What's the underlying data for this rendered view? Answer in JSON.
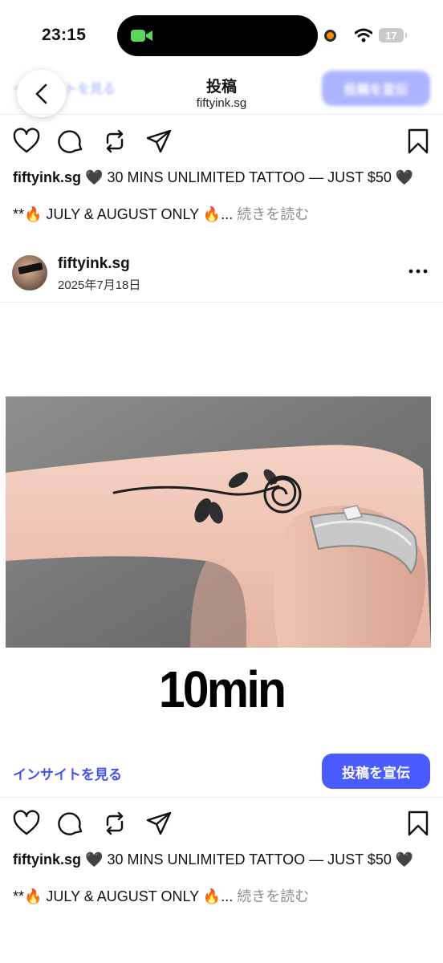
{
  "status_bar": {
    "time": "23:15",
    "battery": "17"
  },
  "header": {
    "title": "投稿",
    "subtitle": "fiftyink.sg",
    "ghost_insight_label": "インサイトを見る",
    "ghost_promote_label": "投稿を宣伝"
  },
  "post_top": {
    "username": "fiftyink.sg",
    "caption": "🖤 30 MINS UNLIMITED TATTOO — JUST $50 🖤",
    "caption_line2": "**🔥 JULY & AUGUST ONLY 🔥...",
    "more_label": "続きを読む"
  },
  "post": {
    "username": "fiftyink.sg",
    "date": "2025年7月18日",
    "image_caption": "10min",
    "insight_label": "インサイトを見る",
    "promote_label": "投稿を宣伝",
    "caption": "🖤 30 MINS UNLIMITED TATTOO — JUST $50 🖤",
    "caption_line2": "**🔥 JULY & AUGUST ONLY 🔥...",
    "more_label": "続きを読む"
  },
  "colors": {
    "accent": "#4a5bff",
    "link": "#4253f5",
    "muted": "#8e8e8e"
  },
  "icons": [
    "facetime-icon",
    "recording-dot-icon",
    "wifi-icon",
    "battery-icon",
    "back-chevron-icon",
    "heart-icon",
    "comment-icon",
    "repost-icon",
    "share-icon",
    "bookmark-icon",
    "more-dots-icon"
  ]
}
